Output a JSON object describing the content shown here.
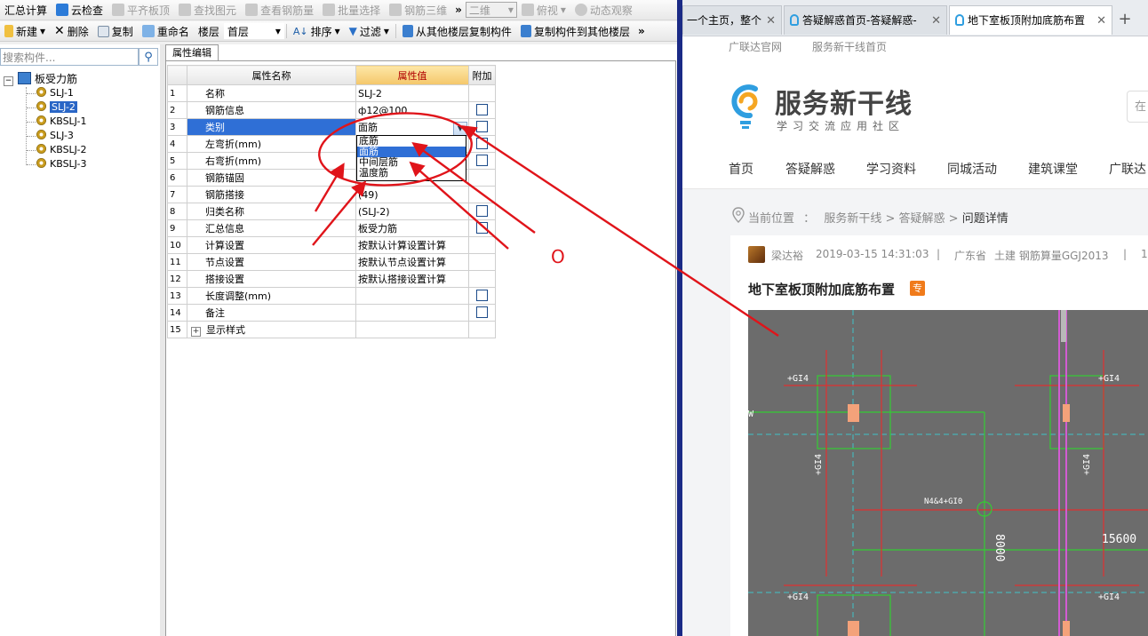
{
  "toolbar1": {
    "sum_calc": "汇总计算",
    "cloud_check": "云检查",
    "align_slab_top": "平齐板顶",
    "find_element": "查找图元",
    "view_rebar_qty": "查看钢筋量",
    "batch_select": "批量选择",
    "rebar_3d": "钢筋三维",
    "view_mode": "二维",
    "view_angle": "俯视",
    "dynamic_view": "动态观察"
  },
  "toolbar2": {
    "new": "新建",
    "delete": "删除",
    "copy": "复制",
    "rename": "重命名",
    "floor_label": "楼层",
    "floor_value": "首层",
    "sort": "排序",
    "filter": "过滤",
    "copy_from_floor": "从其他楼层复制构件",
    "copy_to_floor": "复制构件到其他楼层"
  },
  "left_panel": {
    "search_placeholder": "搜索构件...",
    "tree_root": "板受力筋",
    "tree_items": [
      "SLJ-1",
      "SLJ-2",
      "KBSLJ-1",
      "SLJ-3",
      "KBSLJ-2",
      "KBSLJ-3"
    ],
    "selected_index": 1
  },
  "property_panel": {
    "tab_label": "属性编辑",
    "headers": {
      "name": "属性名称",
      "value": "属性值",
      "extra": "附加"
    },
    "rows": [
      {
        "no": "1",
        "name": "名称",
        "value": "SLJ-2",
        "checkbox": false
      },
      {
        "no": "2",
        "name": "钢筋信息",
        "value": "ф12@100",
        "checkbox": true
      },
      {
        "no": "3",
        "name": "类别",
        "value": "面筋",
        "checkbox": true
      },
      {
        "no": "4",
        "name": "左弯折(mm)",
        "value": "",
        "checkbox": true
      },
      {
        "no": "5",
        "name": "右弯折(mm)",
        "value": "",
        "checkbox": true
      },
      {
        "no": "6",
        "name": "钢筋锚固",
        "value": "",
        "checkbox": false
      },
      {
        "no": "7",
        "name": "钢筋搭接",
        "value": "(49)",
        "checkbox": false
      },
      {
        "no": "8",
        "name": "归类名称",
        "value": "(SLJ-2)",
        "checkbox": true
      },
      {
        "no": "9",
        "name": "汇总信息",
        "value": "板受力筋",
        "checkbox": true
      },
      {
        "no": "10",
        "name": "计算设置",
        "value": "按默认计算设置计算",
        "checkbox": false
      },
      {
        "no": "11",
        "name": "节点设置",
        "value": "按默认节点设置计算",
        "checkbox": false
      },
      {
        "no": "12",
        "name": "搭接设置",
        "value": "按默认搭接设置计算",
        "checkbox": false
      },
      {
        "no": "13",
        "name": "长度调整(mm)",
        "value": "",
        "checkbox": true
      },
      {
        "no": "14",
        "name": "备注",
        "value": "",
        "checkbox": true
      },
      {
        "no": "15",
        "name": "显示样式",
        "value": "",
        "checkbox": false
      }
    ],
    "dropdown_options": [
      "底筋",
      "面筋",
      "中间层筋",
      "温度筋"
    ],
    "dropdown_highlighted": 1
  },
  "browser": {
    "tabs": [
      {
        "label": "一个主页，整个"
      },
      {
        "label": "答疑解惑首页-答疑解惑-"
      },
      {
        "label": "地下室板顶附加底筋布置"
      }
    ],
    "top_links": [
      "广联达官网",
      "服务新干线首页"
    ],
    "brand": "服务新干线",
    "slogan": "学习交流应用社区",
    "search_stub": "在",
    "nav": [
      "首页",
      "答疑解惑",
      "学习资料",
      "同城活动",
      "建筑课堂",
      "广联达"
    ],
    "breadcrumb": {
      "label": "当前位置",
      "sep": "：",
      "level1": "服务新干线",
      "level2": "答疑解惑",
      "current": "问题详情",
      "arrow": ">"
    },
    "post": {
      "author": "梁达裕",
      "datetime": "2019-03-15 14:31:03",
      "location": "广东省",
      "tags": "土建 钢筋算量GGJ2013",
      "extra": "1",
      "divider": "|",
      "title": "地下室板顶附加底筋布置",
      "badge": "专"
    },
    "cad_labels": [
      "+GI4",
      "+GI4",
      "+GI4",
      "+GI4",
      "+GI4",
      "+GI4",
      "W",
      "N4&4+GI0",
      "8000",
      "15600"
    ]
  },
  "annotation": {
    "circle_mark": "O",
    "color": "#e0141a"
  },
  "colors": {
    "selection": "#2f6fd6",
    "header_value": "#f4c76a",
    "brand_blue": "#2f9ee0",
    "brand_orange": "#f5a623",
    "badge": "#f07b1b"
  }
}
